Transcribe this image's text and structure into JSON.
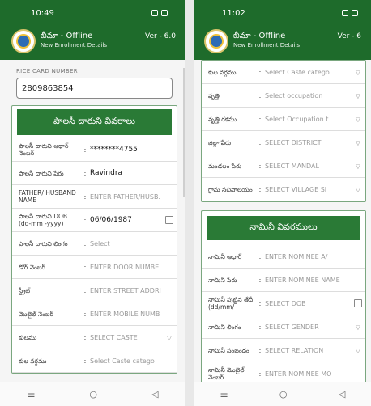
{
  "left": {
    "time": "10:49",
    "app_title": "బీమా - Offline",
    "app_subtitle": "New Enrollment Details",
    "version": "Ver - 6.0",
    "rice_card": {
      "label": "RICE CARD NUMBER",
      "value": "2809863854"
    },
    "section_title": "పాలసీ దారుని వివరాలు",
    "rows": [
      {
        "label": "పాలసీ దారుని ఆధార్ నెంబర్",
        "value": "********4755",
        "filled": true,
        "icon": ""
      },
      {
        "label": "పాలసీ దారుని పేరు",
        "value": "Ravindra",
        "filled": true,
        "icon": ""
      },
      {
        "label": "FATHER/ HUSBAND NAME",
        "value": "ENTER FATHER/HUSB.",
        "filled": false,
        "icon": ""
      },
      {
        "label": "పాలసీ దారుని DOB (dd-mm -yyyy)",
        "value": "06/06/1987",
        "filled": true,
        "icon": "calendar-icon"
      },
      {
        "label": "పాలసీ దారుని లింగం",
        "value": "Select",
        "filled": false,
        "icon": ""
      },
      {
        "label": "డోర్ నెంబర్",
        "value": "ENTER DOOR NUMBEI",
        "filled": false,
        "icon": ""
      },
      {
        "label": "స్ట్రీట్",
        "value": "ENTER STREET ADDRI",
        "filled": false,
        "icon": ""
      },
      {
        "label": "మొబైల్ నెంబర్",
        "value": "ENTER MOBILE NUMB",
        "filled": false,
        "icon": ""
      },
      {
        "label": "కులము",
        "value": "SELECT CASTE",
        "filled": false,
        "icon": "dropdown-icon"
      },
      {
        "label": "కుల వర్గము",
        "value": "Select Caste catego",
        "filled": false,
        "icon": ""
      }
    ]
  },
  "right": {
    "time": "11:02",
    "app_title": "బీమా - Offline",
    "app_subtitle": "New Enrollment Details",
    "version": "Ver - 6",
    "rows": [
      {
        "label": "కుల వర్గము",
        "value": "Select Caste catego",
        "icon": "dropdown-icon"
      },
      {
        "label": "వృత్తి",
        "value": "Select occupation",
        "icon": "dropdown-icon"
      },
      {
        "label": "వృత్తి రకము",
        "value": "Select Occupation t",
        "icon": "dropdown-icon"
      },
      {
        "label": "జిల్లా పేరు",
        "value": "SELECT DISTRICT",
        "icon": "dropdown-icon"
      },
      {
        "label": "మండలం పేరు",
        "value": "SELECT MANDAL",
        "icon": "dropdown-icon"
      },
      {
        "label": "గ్రామ సచివాలయం",
        "value": "SELECT VILLAGE SI",
        "icon": "dropdown-icon"
      }
    ],
    "nominee_title": "నామినీ వివరములు",
    "nominee_rows": [
      {
        "label": "నామినీ ఆధార్",
        "value": "ENTER NOMINEE A/",
        "icon": ""
      },
      {
        "label": "నామినీ పేరు",
        "value": "ENTER NOMINEE NAME",
        "icon": ""
      },
      {
        "label": "నామినీ పుట్టిన తేదీ (dd/mm/",
        "value": "SELECT DOB",
        "icon": "calendar-icon"
      },
      {
        "label": "నామినీ లింగం",
        "value": "SELECT GENDER",
        "icon": "dropdown-icon"
      },
      {
        "label": "నామినీ సంబంధం",
        "value": "SELECT RELATION",
        "icon": "dropdown-icon"
      },
      {
        "label": "నామినీ మొబైల్ నెంబర్",
        "value": "ENTER NOMINEE MO",
        "icon": ""
      }
    ]
  },
  "colors": {
    "appbar": "#1e6b2b",
    "section_head": "#2a7a36"
  },
  "nav": {
    "menu_icon": "☰",
    "home_icon": "○",
    "back_icon": "◁"
  }
}
